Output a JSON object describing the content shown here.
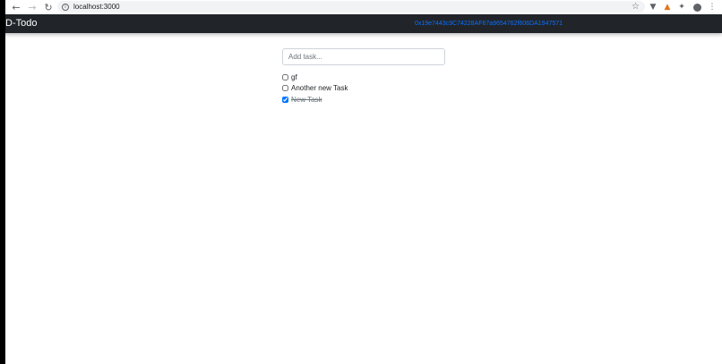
{
  "browser": {
    "url": "localhost:3000",
    "icons": {
      "back": "arrow-left-icon",
      "forward": "arrow-right-icon",
      "reload": "reload-icon",
      "info": "info-icon",
      "bookmark": "star-icon"
    },
    "extensions": [
      "vpn-extension-icon",
      "metamask-fox-icon",
      "puzzle-extensions-icon",
      "profile-avatar-icon",
      "kebab-menu-icon"
    ]
  },
  "navbar": {
    "brand": "D-Todo",
    "account": "0x19e7443c9C74228AF67a9654762f606DA1947571",
    "colors": {
      "background": "#212529",
      "brand": "#ffffff",
      "account": "#0d6efd"
    }
  },
  "task_input": {
    "placeholder": "Add task...",
    "value": ""
  },
  "tasks": [
    {
      "content": "gf",
      "completed": false
    },
    {
      "content": "Another new Task",
      "completed": false
    },
    {
      "content": "New Task",
      "completed": true
    }
  ]
}
